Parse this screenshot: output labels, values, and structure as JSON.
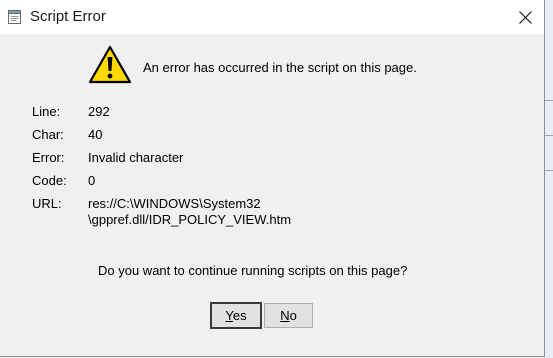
{
  "window": {
    "title": "Script Error",
    "close_icon": "close-icon",
    "app_icon": "document-icon"
  },
  "message": {
    "icon": "warning-icon",
    "text": "An error has occurred in the script on this page."
  },
  "details": {
    "line_label": "Line:",
    "line_value": "292",
    "char_label": "Char:",
    "char_value": "40",
    "error_label": "Error:",
    "error_value": "Invalid character",
    "code_label": "Code:",
    "code_value": "0",
    "url_label": "URL:",
    "url_value_line1": "res://C:\\WINDOWS\\System32",
    "url_value_line2": "\\gppref.dll/IDR_POLICY_VIEW.htm"
  },
  "question": "Do you want to continue running scripts on this page?",
  "buttons": {
    "yes_accel": "Y",
    "yes_rest": "es",
    "no_accel": "N",
    "no_rest": "o"
  },
  "colors": {
    "titlebar": "#ffffff",
    "dialog_bg": "#f0f0f0",
    "warning_fill": "#ffd800",
    "button_bg": "#e1e1e1"
  }
}
